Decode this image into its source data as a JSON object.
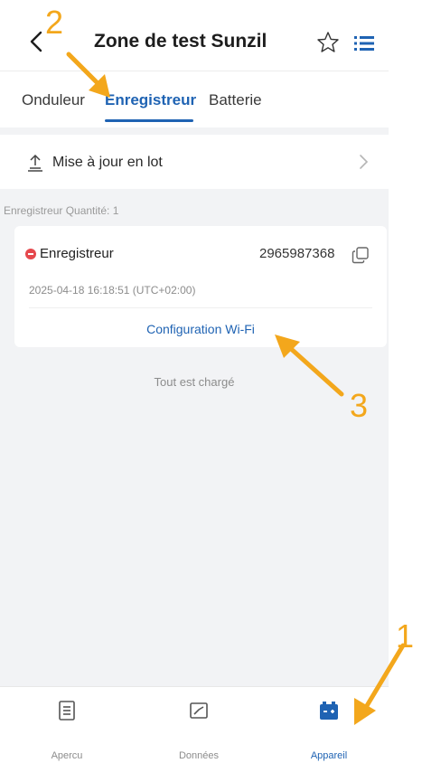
{
  "header": {
    "title": "Zone de test Sunzil",
    "back_icon": "chevron-left-icon",
    "favorite_icon": "star-outline-icon",
    "menu_icon": "list-menu-icon"
  },
  "tabs": [
    {
      "label": "Onduleur",
      "active": false
    },
    {
      "label": "Enregistreur",
      "active": true
    },
    {
      "label": "Batterie",
      "active": false
    }
  ],
  "batch_update": {
    "label": "Mise à jour en lot",
    "icon": "upload-icon"
  },
  "list": {
    "quantity_label": "Enregistreur Quantité: 1",
    "device": {
      "status": "offline",
      "status_color": "#e5484d",
      "name": "Enregistreur",
      "serial": "2965987368",
      "timestamp": "2025-04-18 16:18:51 (UTC+02:00)",
      "wifi_config_label": "Configuration Wi-Fi"
    },
    "end_text": "Tout est chargé"
  },
  "bottom_nav": [
    {
      "label": "Apercu",
      "icon": "document-icon",
      "active": false
    },
    {
      "label": "Données",
      "icon": "chart-icon",
      "active": false
    },
    {
      "label": "Appareil",
      "icon": "device-battery-icon",
      "active": true
    }
  ],
  "annotations": {
    "step1": "1",
    "step2": "2",
    "step3": "3",
    "color": "#f3a71c"
  },
  "colors": {
    "accent": "#1f63b3",
    "background_grey": "#f2f3f5",
    "error_red": "#e5484d"
  }
}
